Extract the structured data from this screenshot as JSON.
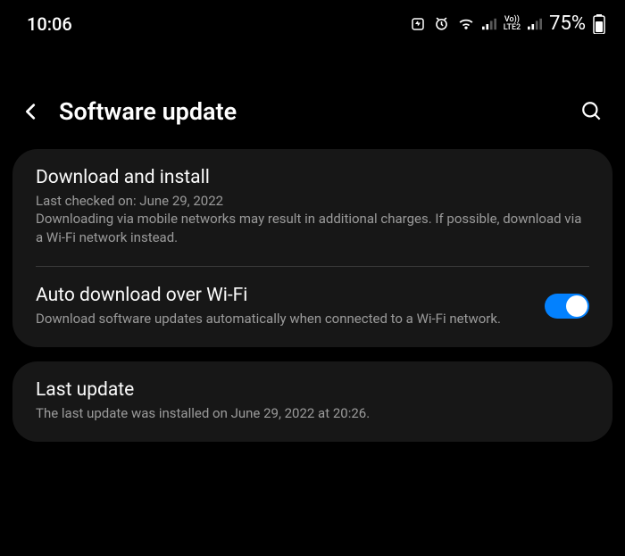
{
  "status": {
    "time": "10:06",
    "network_label": "LTE2",
    "volte_label": "Vo))",
    "battery_pct": "75%"
  },
  "header": {
    "title": "Software update"
  },
  "sections": {
    "download": {
      "title": "Download and install",
      "last_checked": "Last checked on: June 29, 2022",
      "note": "Downloading via mobile networks may result in additional charges. If possible, download via a Wi-Fi network instead."
    },
    "auto": {
      "title": "Auto download over Wi-Fi",
      "desc": "Download software updates automatically when connected to a Wi-Fi network.",
      "enabled": true
    },
    "last_update": {
      "title": "Last update",
      "desc": "The last update was installed on June 29, 2022 at 20:26."
    }
  }
}
